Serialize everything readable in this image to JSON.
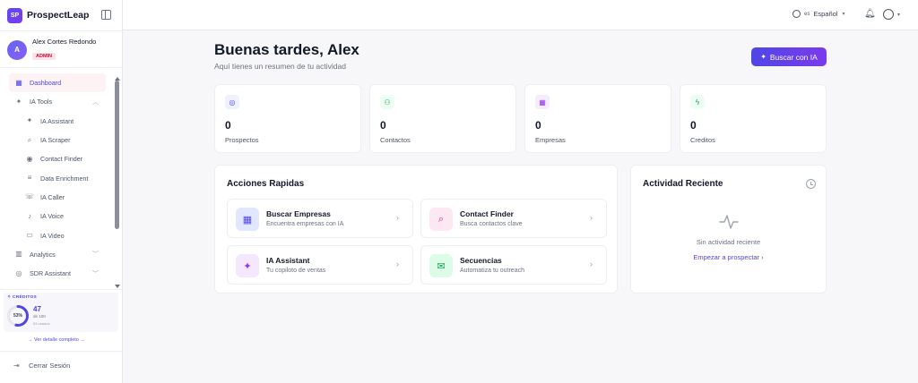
{
  "brand": {
    "logo_text": "SP",
    "name": "ProspectLeap"
  },
  "user": {
    "initial": "A",
    "name": "Alex Cortes Redondo",
    "role": "ADMIN"
  },
  "nav": [
    {
      "label": "Dashboard",
      "icon": "dashboard-icon",
      "active": true
    },
    {
      "label": "IA Tools",
      "icon": "sparkles-icon",
      "expanded": true
    },
    {
      "label": "IA Assistant",
      "icon": "sparkles-icon",
      "sub": true
    },
    {
      "label": "IA Scraper",
      "icon": "search-icon",
      "sub": true
    },
    {
      "label": "Contact Finder",
      "icon": "user-circle-icon",
      "sub": true
    },
    {
      "label": "Data Enrichment",
      "icon": "database-icon",
      "sub": true
    },
    {
      "label": "IA Caller",
      "icon": "phone-icon",
      "sub": true
    },
    {
      "label": "IA Voice",
      "icon": "microphone-icon",
      "sub": true
    },
    {
      "label": "IA Video",
      "icon": "video-icon",
      "sub": true
    },
    {
      "label": "Analytics",
      "icon": "bar-chart-icon"
    },
    {
      "label": "SDR Assistant",
      "icon": "target-icon"
    }
  ],
  "credits": {
    "label": "CRÉDITOS",
    "percent_text": "53%",
    "percent": 53,
    "value": "47",
    "of_text": "de 100",
    "rest_text": "53 usados",
    "link": "→ Ver detalle completo →"
  },
  "logout_label": "Cerrar Sesión",
  "topbar": {
    "lang_code": "es",
    "lang_label": "Español"
  },
  "greeting": "Buenas tardes, Alex",
  "subtitle": "Aquí tienes un resumen de tu actividad",
  "cta_label": "Buscar con IA",
  "stats": [
    {
      "value": "0",
      "label": "Prospectos",
      "icon": "target-icon",
      "color": "#4f46e5",
      "bg": "#eef2ff"
    },
    {
      "value": "0",
      "label": "Contactos",
      "icon": "users-icon",
      "color": "#16a34a",
      "bg": "#ecfdf3"
    },
    {
      "value": "0",
      "label": "Empresas",
      "icon": "building-icon",
      "color": "#9333ea",
      "bg": "#f5edff"
    },
    {
      "value": "0",
      "label": "Creditos",
      "icon": "lightning-icon",
      "color": "#16a34a",
      "bg": "#ecfdf3"
    }
  ],
  "quick_actions": {
    "title": "Acciones Rapidas",
    "items": [
      {
        "title": "Buscar Empresas",
        "desc": "Encuentra empresas con IA",
        "icon": "building-icon",
        "color": "#4f46e5",
        "bg": "#e0e7ff"
      },
      {
        "title": "Contact Finder",
        "desc": "Busca contactos clave",
        "icon": "search-icon",
        "color": "#db2777",
        "bg": "#fce7f3"
      },
      {
        "title": "IA Assistant",
        "desc": "Tu copiloto de ventas",
        "icon": "sparkles-icon",
        "color": "#9333ea",
        "bg": "#f3e8ff"
      },
      {
        "title": "Secuencias",
        "desc": "Automatiza tu outreach",
        "icon": "mail-icon",
        "color": "#16a34a",
        "bg": "#dcfce7"
      }
    ]
  },
  "recent": {
    "title": "Actividad Reciente",
    "empty": "Sin actividad reciente",
    "link": "Empezar a prospectar ›"
  }
}
